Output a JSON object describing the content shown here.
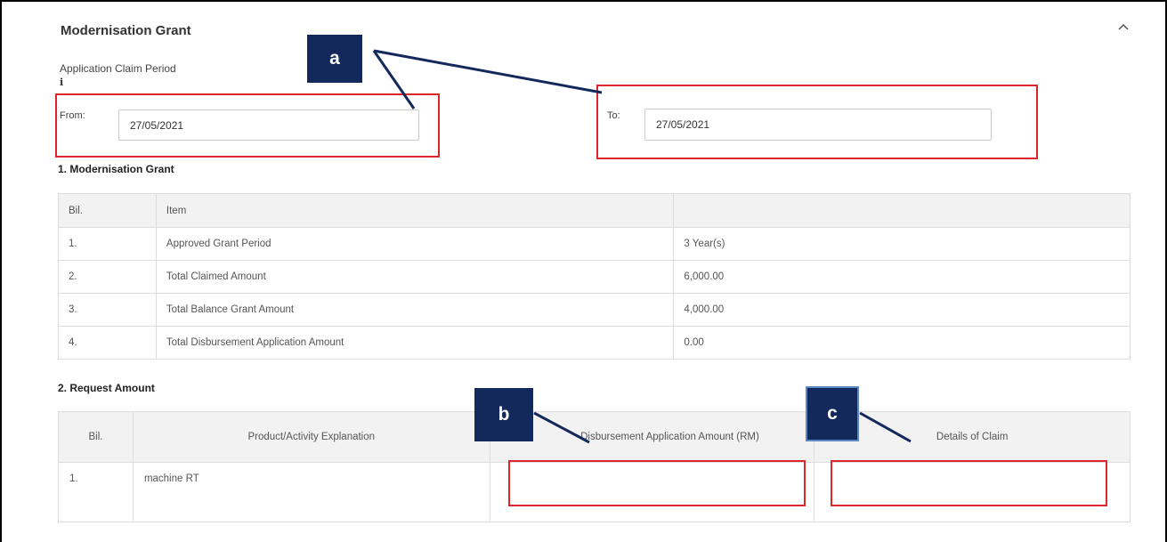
{
  "section": {
    "title": "Modernisation Grant",
    "collapse_icon": "chevron-up-icon"
  },
  "claim_period": {
    "label": "Application Claim Period",
    "info_icon": "i",
    "from_label": "From:",
    "from_value": "27/05/2021",
    "to_label": "To:",
    "to_value": "27/05/2021"
  },
  "grant_table": {
    "title": "1. Modernisation Grant",
    "headers": [
      "Bil.",
      "Item",
      ""
    ],
    "rows": [
      [
        "1.",
        "Approved Grant Period",
        "3 Year(s)"
      ],
      [
        "2.",
        "Total Claimed Amount",
        "6,000.00"
      ],
      [
        "3.",
        "Total Balance Grant Amount",
        "4,000.00"
      ],
      [
        "4.",
        "Total Disbursement Application Amount",
        "0.00"
      ]
    ]
  },
  "request_table": {
    "title": "2. Request Amount",
    "headers": [
      "Bil.",
      "Product/Activity Explanation",
      "Disbursement Application Amount (RM)",
      "Details of Claim"
    ],
    "rows": [
      {
        "bil": "1.",
        "explanation": "machine RT",
        "amount": "",
        "details": ""
      }
    ]
  },
  "callouts": {
    "a": "a",
    "b": "b",
    "c": "c"
  },
  "colors": {
    "highlight": "#e0262d",
    "callout_bg": "#13295b",
    "callout_line": "#13295b"
  }
}
